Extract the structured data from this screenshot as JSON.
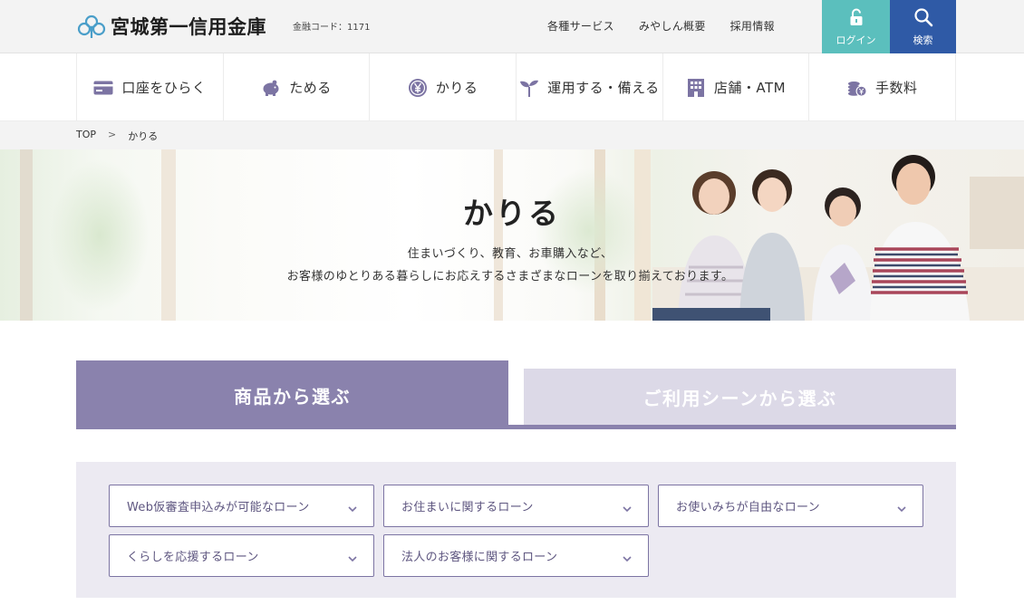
{
  "header": {
    "logo_text": "宮城第一信用金庫",
    "bank_code": "金融コード：1171",
    "utility_links": [
      "各種サービス",
      "みやしん概要",
      "採用情報"
    ],
    "login_label": "ログイン",
    "search_label": "検索",
    "colors": {
      "login": "#5bbfbd",
      "search": "#2f5aa6"
    }
  },
  "gnav": {
    "items": [
      {
        "label": "口座をひらく",
        "icon": "card-icon"
      },
      {
        "label": "ためる",
        "icon": "piggy-bank-icon"
      },
      {
        "label": "かりる",
        "icon": "yen-coin-icon"
      },
      {
        "label": "運用する・備える",
        "icon": "sprout-icon"
      },
      {
        "label": "店舗・ATM",
        "icon": "building-icon"
      },
      {
        "label": "手数料",
        "icon": "coins-icon"
      }
    ],
    "icon_color": "#7c74a3"
  },
  "breadcrumb": {
    "home": "TOP",
    "separator": ">",
    "current": "かりる"
  },
  "hero": {
    "title": "かりる",
    "desc_line1": "住まいづくり、教育、お車購入など、",
    "desc_line2": "お客様のゆとりある暮らしにお応えするさまざまなローンを取り揃えております。"
  },
  "tabs": {
    "active": "商品から選ぶ",
    "inactive": "ご利用シーンから選ぶ",
    "accent": "#8a82ad"
  },
  "filters": [
    "Web仮審査申込みが可能なローン",
    "お住まいに関するローン",
    "お使いみちが自由なローン",
    "くらしを応援するローン",
    "法人のお客様に関するローン"
  ]
}
